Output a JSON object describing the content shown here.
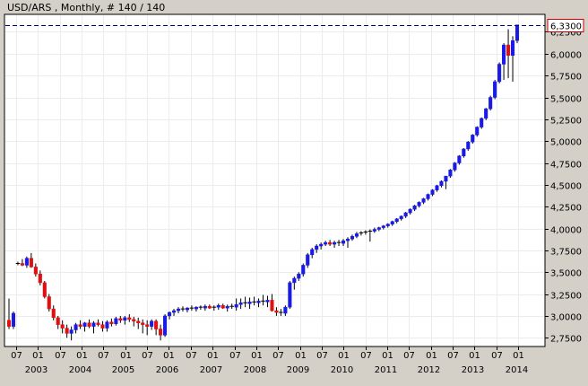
{
  "title": "USD/ARS , Monthly, # 140 / 140",
  "colors": {
    "background": "#d4d0c8",
    "plot_background": "#ffffff",
    "grid": "#ececec",
    "axis": "#000000",
    "up_candle": "#1a1ae6",
    "down_candle": "#e01010",
    "wick": "#000000",
    "last_price_line": "#000080",
    "last_price_box_border": "#cc0000"
  },
  "chart_data": {
    "type": "candlestick",
    "title": "USD/ARS , Monthly, # 140 / 140",
    "last_price_label": "6,3300",
    "ylim": [
      2.65,
      6.45
    ],
    "y_ticks": [
      "2,7500",
      "3,0000",
      "3,2500",
      "3,5000",
      "3,7500",
      "4,0000",
      "4,2500",
      "4,5000",
      "4,7500",
      "5,0000",
      "5,2500",
      "5,5000",
      "5,7500",
      "6,0000",
      "6,2500"
    ],
    "x_ticks": [
      {
        "month": "07",
        "year": "2003"
      },
      {
        "month": "01",
        "year": ""
      },
      {
        "month": "07",
        "year": "2004"
      },
      {
        "month": "01",
        "year": ""
      },
      {
        "month": "07",
        "year": "2005"
      },
      {
        "month": "01",
        "year": ""
      },
      {
        "month": "07",
        "year": "2006"
      },
      {
        "month": "01",
        "year": ""
      },
      {
        "month": "07",
        "year": "2007"
      },
      {
        "month": "01",
        "year": ""
      },
      {
        "month": "07",
        "year": "2008"
      },
      {
        "month": "01",
        "year": ""
      },
      {
        "month": "07",
        "year": "2009"
      },
      {
        "month": "01",
        "year": ""
      },
      {
        "month": "07",
        "year": "2010"
      },
      {
        "month": "01",
        "year": ""
      },
      {
        "month": "07",
        "year": "2011"
      },
      {
        "month": "01",
        "year": ""
      },
      {
        "month": "07",
        "year": "2012"
      },
      {
        "month": "01",
        "year": ""
      },
      {
        "month": "07",
        "year": "2013"
      },
      {
        "month": "01",
        "year": ""
      },
      {
        "month": "07",
        "year": "2014"
      },
      {
        "month": "01",
        "year": ""
      }
    ],
    "candles": [
      [
        2.95,
        3.2,
        2.85,
        2.88
      ],
      [
        2.88,
        3.05,
        2.85,
        3.03
      ],
      [
        3.6,
        3.62,
        3.58,
        3.6
      ],
      [
        3.6,
        3.65,
        3.57,
        3.58
      ],
      [
        3.58,
        3.68,
        3.55,
        3.66
      ],
      [
        3.66,
        3.72,
        3.55,
        3.56
      ],
      [
        3.56,
        3.6,
        3.45,
        3.48
      ],
      [
        3.48,
        3.52,
        3.35,
        3.38
      ],
      [
        3.38,
        3.4,
        3.2,
        3.22
      ],
      [
        3.22,
        3.25,
        3.05,
        3.08
      ],
      [
        3.08,
        3.12,
        2.95,
        2.98
      ],
      [
        2.98,
        3.0,
        2.85,
        2.9
      ],
      [
        2.9,
        2.95,
        2.8,
        2.86
      ],
      [
        2.86,
        2.9,
        2.75,
        2.8
      ],
      [
        2.8,
        2.88,
        2.72,
        2.84
      ],
      [
        2.84,
        2.92,
        2.8,
        2.9
      ],
      [
        2.9,
        2.95,
        2.85,
        2.88
      ],
      [
        2.88,
        2.93,
        2.82,
        2.92
      ],
      [
        2.92,
        2.96,
        2.86,
        2.88
      ],
      [
        2.88,
        2.94,
        2.8,
        2.92
      ],
      [
        2.92,
        2.96,
        2.88,
        2.9
      ],
      [
        2.9,
        2.94,
        2.82,
        2.86
      ],
      [
        2.86,
        2.95,
        2.82,
        2.93
      ],
      [
        2.93,
        2.97,
        2.88,
        2.91
      ],
      [
        2.91,
        2.99,
        2.89,
        2.97
      ],
      [
        2.97,
        3.0,
        2.92,
        2.95
      ],
      [
        2.95,
        3.0,
        2.9,
        2.98
      ],
      [
        2.98,
        3.02,
        2.93,
        2.96
      ],
      [
        2.96,
        2.99,
        2.88,
        2.94
      ],
      [
        2.94,
        2.98,
        2.85,
        2.92
      ],
      [
        2.92,
        2.96,
        2.8,
        2.9
      ],
      [
        2.9,
        2.95,
        2.78,
        2.88
      ],
      [
        2.88,
        2.96,
        2.84,
        2.94
      ],
      [
        2.94,
        2.96,
        2.78,
        2.85
      ],
      [
        2.85,
        2.9,
        2.72,
        2.78
      ],
      [
        2.78,
        3.02,
        2.76,
        3.0
      ],
      [
        3.0,
        3.05,
        2.96,
        3.04
      ],
      [
        3.04,
        3.08,
        3.0,
        3.06
      ],
      [
        3.06,
        3.1,
        3.03,
        3.08
      ],
      [
        3.08,
        3.11,
        3.05,
        3.07
      ],
      [
        3.07,
        3.1,
        3.04,
        3.09
      ],
      [
        3.09,
        3.12,
        3.06,
        3.08
      ],
      [
        3.08,
        3.11,
        3.05,
        3.1
      ],
      [
        3.1,
        3.12,
        3.07,
        3.09
      ],
      [
        3.09,
        3.13,
        3.06,
        3.11
      ],
      [
        3.11,
        3.13,
        3.08,
        3.09
      ],
      [
        3.09,
        3.12,
        3.06,
        3.1
      ],
      [
        3.1,
        3.14,
        3.07,
        3.12
      ],
      [
        3.12,
        3.14,
        3.08,
        3.09
      ],
      [
        3.09,
        3.13,
        3.05,
        3.11
      ],
      [
        3.11,
        3.14,
        3.08,
        3.1
      ],
      [
        3.1,
        3.2,
        3.06,
        3.13
      ],
      [
        3.13,
        3.2,
        3.08,
        3.15
      ],
      [
        3.15,
        3.22,
        3.1,
        3.14
      ],
      [
        3.14,
        3.21,
        3.08,
        3.16
      ],
      [
        3.16,
        3.22,
        3.12,
        3.15
      ],
      [
        3.15,
        3.2,
        3.1,
        3.17
      ],
      [
        3.17,
        3.24,
        3.12,
        3.16
      ],
      [
        3.16,
        3.23,
        3.1,
        3.18
      ],
      [
        3.18,
        3.25,
        3.05,
        3.06
      ],
      [
        3.06,
        3.1,
        3.0,
        3.04
      ],
      [
        3.04,
        3.08,
        3.0,
        3.03
      ],
      [
        3.03,
        3.12,
        3.0,
        3.1
      ],
      [
        3.1,
        3.4,
        3.08,
        3.38
      ],
      [
        3.38,
        3.45,
        3.3,
        3.43
      ],
      [
        3.43,
        3.5,
        3.4,
        3.48
      ],
      [
        3.48,
        3.6,
        3.45,
        3.58
      ],
      [
        3.58,
        3.72,
        3.55,
        3.7
      ],
      [
        3.7,
        3.78,
        3.66,
        3.76
      ],
      [
        3.76,
        3.82,
        3.72,
        3.8
      ],
      [
        3.8,
        3.84,
        3.76,
        3.82
      ],
      [
        3.82,
        3.86,
        3.8,
        3.84
      ],
      [
        3.84,
        3.87,
        3.8,
        3.82
      ],
      [
        3.82,
        3.86,
        3.78,
        3.84
      ],
      [
        3.84,
        3.87,
        3.8,
        3.83
      ],
      [
        3.83,
        3.88,
        3.8,
        3.86
      ],
      [
        3.86,
        3.9,
        3.78,
        3.88
      ],
      [
        3.88,
        3.93,
        3.86,
        3.91
      ],
      [
        3.91,
        3.96,
        3.89,
        3.94
      ],
      [
        3.94,
        3.97,
        3.92,
        3.95
      ],
      [
        3.95,
        3.98,
        3.93,
        3.96
      ],
      [
        3.96,
        3.99,
        3.85,
        3.97
      ],
      [
        3.97,
        4.01,
        3.95,
        3.99
      ],
      [
        3.99,
        4.02,
        3.97,
        4.01
      ],
      [
        4.01,
        4.04,
        3.99,
        4.03
      ],
      [
        4.03,
        4.06,
        4.01,
        4.05
      ],
      [
        4.05,
        4.09,
        4.03,
        4.08
      ],
      [
        4.08,
        4.12,
        4.06,
        4.11
      ],
      [
        4.11,
        4.15,
        4.09,
        4.14
      ],
      [
        4.14,
        4.19,
        4.12,
        4.18
      ],
      [
        4.18,
        4.23,
        4.16,
        4.22
      ],
      [
        4.22,
        4.27,
        4.2,
        4.26
      ],
      [
        4.26,
        4.31,
        4.24,
        4.3
      ],
      [
        4.3,
        4.35,
        4.28,
        4.34
      ],
      [
        4.34,
        4.4,
        4.32,
        4.39
      ],
      [
        4.39,
        4.45,
        4.37,
        4.44
      ],
      [
        4.44,
        4.5,
        4.42,
        4.49
      ],
      [
        4.49,
        4.55,
        4.47,
        4.54
      ],
      [
        4.54,
        4.6,
        4.45,
        4.6
      ],
      [
        4.6,
        4.68,
        4.58,
        4.67
      ],
      [
        4.67,
        4.76,
        4.65,
        4.75
      ],
      [
        4.75,
        4.84,
        4.73,
        4.83
      ],
      [
        4.83,
        4.92,
        4.81,
        4.91
      ],
      [
        4.91,
        5.0,
        4.89,
        4.99
      ],
      [
        4.99,
        5.08,
        4.97,
        5.07
      ],
      [
        5.07,
        5.17,
        5.05,
        5.16
      ],
      [
        5.16,
        5.27,
        5.14,
        5.26
      ],
      [
        5.26,
        5.38,
        5.24,
        5.37
      ],
      [
        5.37,
        5.52,
        5.35,
        5.5
      ],
      [
        5.5,
        5.7,
        5.48,
        5.68
      ],
      [
        5.68,
        5.9,
        5.66,
        5.88
      ],
      [
        5.88,
        6.12,
        5.7,
        6.1
      ],
      [
        6.1,
        6.28,
        5.72,
        5.98
      ],
      [
        5.98,
        6.2,
        5.68,
        6.15
      ],
      [
        6.15,
        6.33,
        6.12,
        6.33
      ]
    ]
  }
}
